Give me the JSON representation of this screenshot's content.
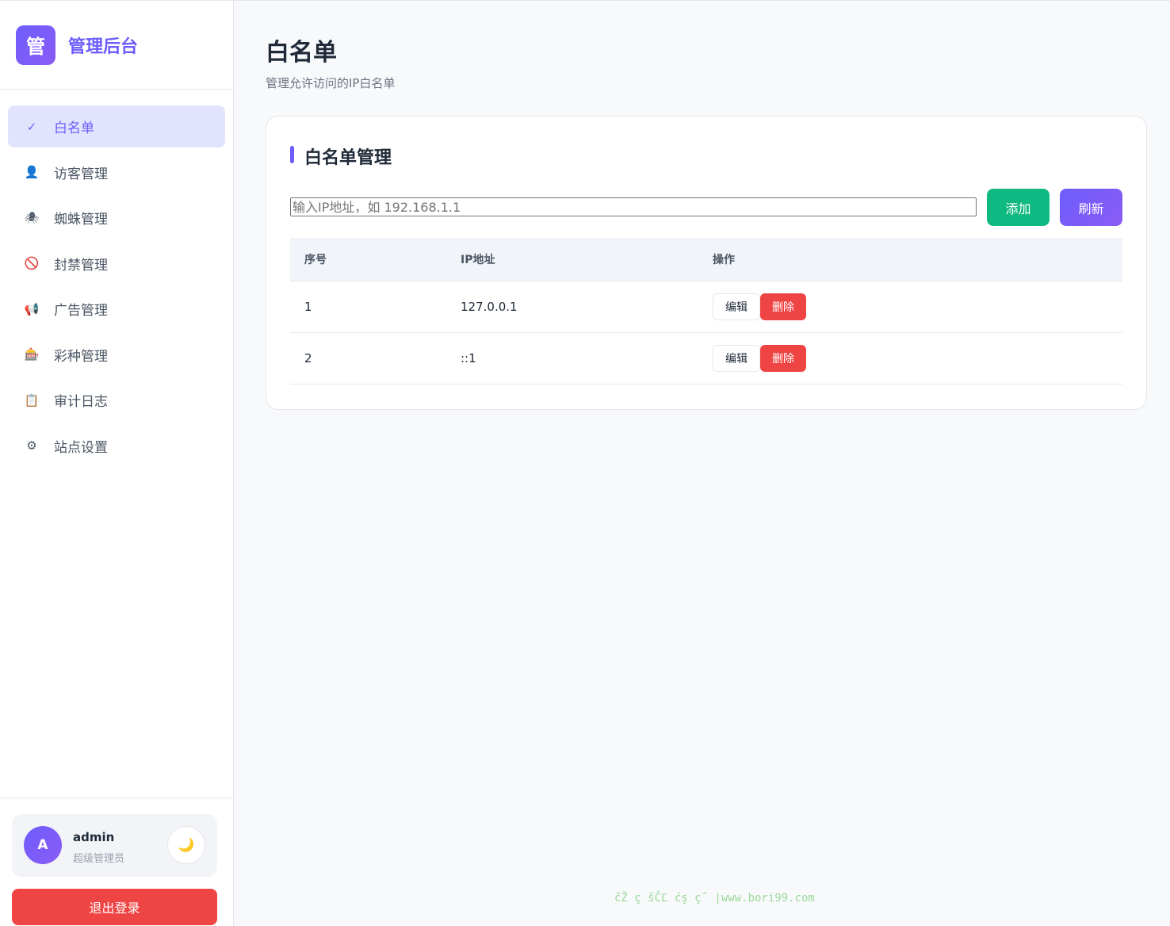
{
  "brand": {
    "logo_char": "管",
    "name": "管理后台"
  },
  "sidebar": {
    "items": [
      {
        "icon": "check-icon",
        "glyph": "✓",
        "label": "白名单",
        "active": true
      },
      {
        "icon": "visitor-icon",
        "glyph": "👤",
        "label": "访客管理"
      },
      {
        "icon": "spider-icon",
        "glyph": "🕷",
        "label": "蜘蛛管理"
      },
      {
        "icon": "ban-icon",
        "glyph": "🚫",
        "label": "封禁管理"
      },
      {
        "icon": "megaphone-icon",
        "glyph": "📢",
        "label": "广告管理"
      },
      {
        "icon": "slot-machine-icon",
        "glyph": "🎰",
        "label": "彩种管理"
      },
      {
        "icon": "clipboard-icon",
        "glyph": "📋",
        "label": "审计日志"
      },
      {
        "icon": "gear-icon",
        "glyph": "⚙",
        "label": "站点设置"
      }
    ]
  },
  "user": {
    "avatar_letter": "A",
    "name": "admin",
    "role": "超级管理员",
    "theme_glyph": "🌙"
  },
  "logout_label": "退出登录",
  "page": {
    "title": "白名单",
    "subtitle": "管理允许访问的IP白名单"
  },
  "card": {
    "title": "白名单管理",
    "input_placeholder": "输入IP地址，如 192.168.1.1",
    "add_label": "添加",
    "refresh_label": "刷新"
  },
  "table": {
    "headers": [
      "序号",
      "IP地址",
      "操作"
    ],
    "rows": [
      {
        "index": "1",
        "ip": "127.0.0.1",
        "edit": "编辑",
        "delete": "删除"
      },
      {
        "index": "2",
        "ip": "::1",
        "edit": "编辑",
        "delete": "删除"
      }
    ]
  },
  "footer_text": "čŽ ç šČĽ ćş ç˝ |www.bori99.com",
  "colors": {
    "accent": "#6d5dfc",
    "success": "#10b981",
    "danger": "#ef4444"
  }
}
